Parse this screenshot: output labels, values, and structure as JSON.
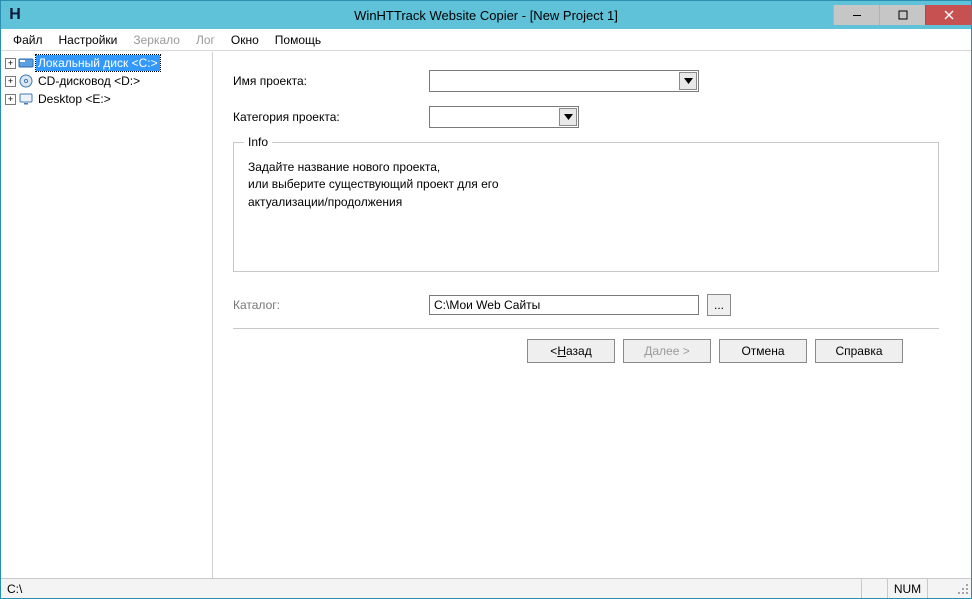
{
  "titlebar": {
    "icon_letter": "H",
    "title": "WinHTTrack Website Copier - [New Project 1]"
  },
  "menu": {
    "file": "Файл",
    "settings": "Настройки",
    "mirror": "Зеркало",
    "log": "Лог",
    "window": "Окно",
    "help": "Помощь"
  },
  "tree": {
    "items": [
      {
        "label": "Локальный диск <C:>",
        "selected": true,
        "icon": "disk"
      },
      {
        "label": "CD-дисковод <D:>",
        "selected": false,
        "icon": "cd"
      },
      {
        "label": "Desktop <E:>",
        "selected": false,
        "icon": "monitor"
      }
    ]
  },
  "form": {
    "project_name_label": "Имя проекта:",
    "project_category_label": "Категория проекта:",
    "info_legend": "Info",
    "info_line1": "Задайте название нового проекта,",
    "info_line2": "или выберите существующий проект для его",
    "info_line3": "актуализации/продолжения",
    "catalog_label": "Каталог:",
    "catalog_value": "C:\\Мои Web Сайты",
    "browse_label": "..."
  },
  "buttons": {
    "back_prefix": "< ",
    "back_ul": "Н",
    "back_suffix": "азад",
    "next_prefix": "",
    "next_ul": "Д",
    "next_suffix": "алее >",
    "cancel": "Отмена",
    "help": "Справка"
  },
  "statusbar": {
    "path": "C:\\",
    "num": "NUM"
  }
}
